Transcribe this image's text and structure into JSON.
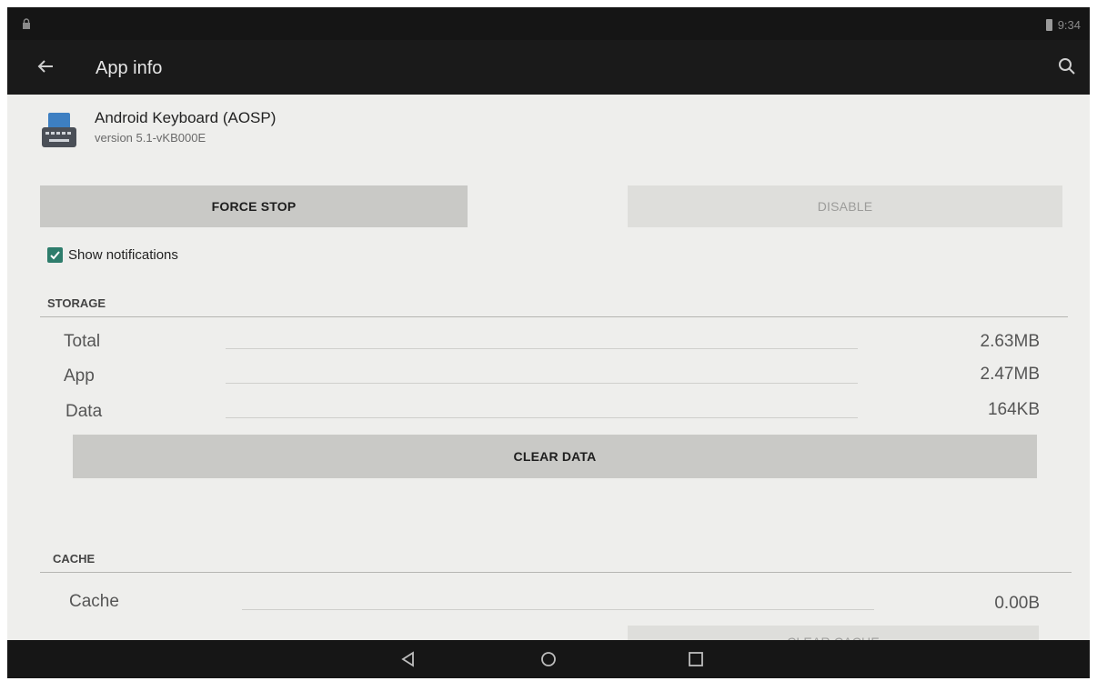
{
  "status_bar": {
    "time": "9:34"
  },
  "toolbar": {
    "title": "App info"
  },
  "app": {
    "name": "Android Keyboard (AOSP)",
    "version": "version 5.1-vKB000E"
  },
  "buttons": {
    "force_stop": "FORCE STOP",
    "disable": "DISABLE",
    "clear_data": "CLEAR DATA",
    "clear_cache": "CLEAR CACHE"
  },
  "notifications": {
    "label": "Show notifications",
    "checked": true
  },
  "storage": {
    "heading": "STORAGE",
    "rows": [
      {
        "label": "Total",
        "value": "2.63MB"
      },
      {
        "label": "App",
        "value": "2.47MB"
      },
      {
        "label": "Data",
        "value": "164KB"
      }
    ]
  },
  "cache": {
    "heading": "CACHE",
    "rows": [
      {
        "label": "Cache",
        "value": "0.00B"
      }
    ]
  },
  "colors": {
    "accent": "#2e7d6c",
    "toolbar": "#1a1a1a",
    "background": "#eeeeec"
  },
  "icons": [
    "lock-icon",
    "battery-icon",
    "back-arrow-icon",
    "search-icon",
    "keyboard-app-icon",
    "check-icon",
    "nav-back-icon",
    "nav-home-icon",
    "nav-recents-icon"
  ]
}
